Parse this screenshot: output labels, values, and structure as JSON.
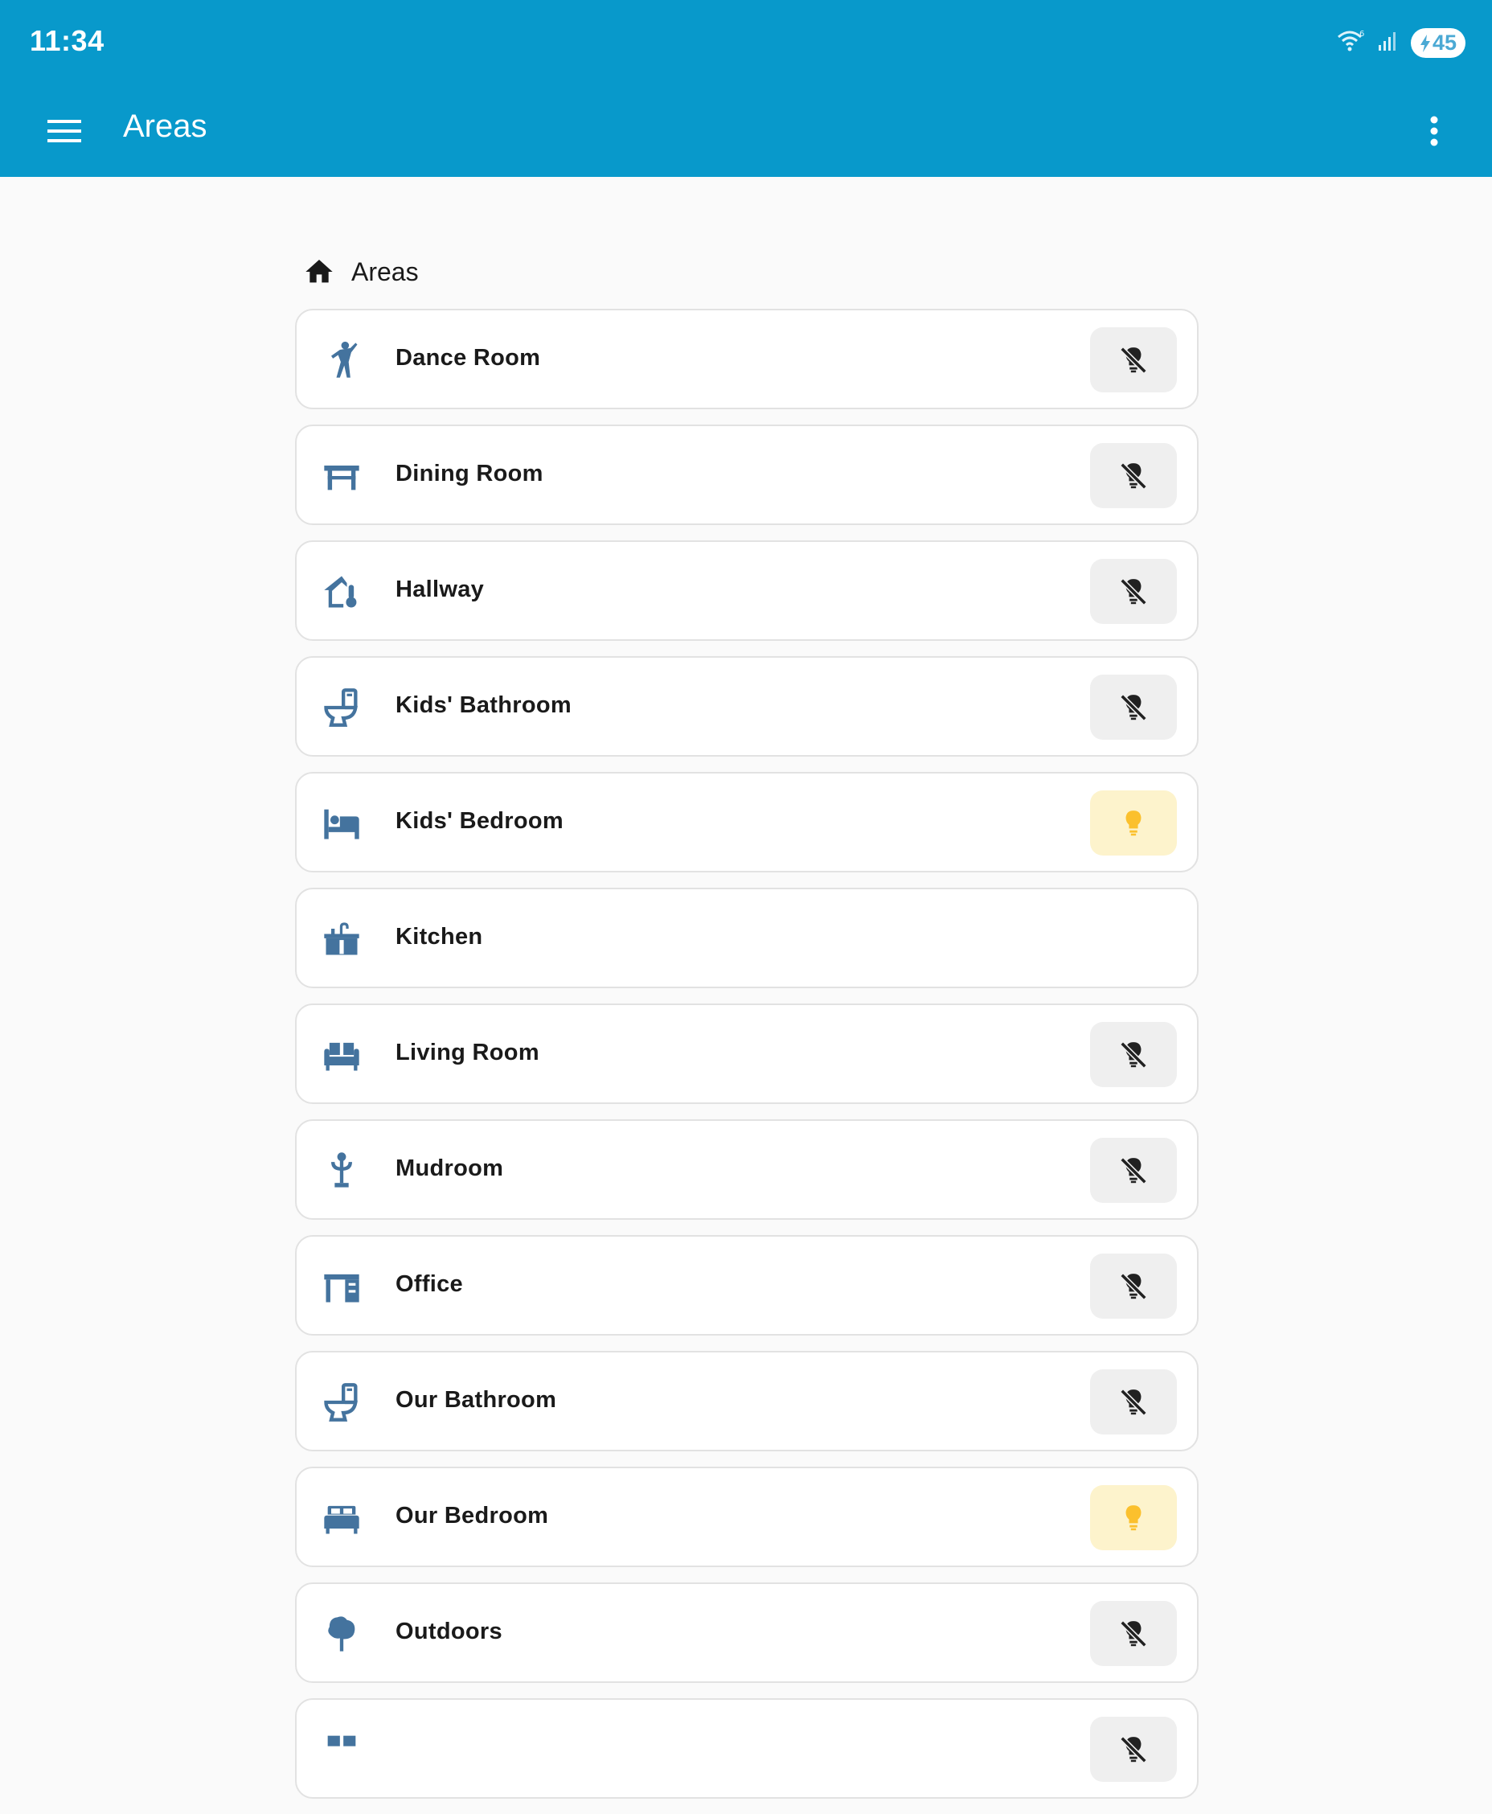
{
  "status_bar": {
    "time": "11:34",
    "battery_level": "45",
    "icons": [
      "wifi-icon",
      "signal-icon",
      "battery-charging-icon"
    ]
  },
  "app_bar": {
    "title": "Areas",
    "menu_icon": "menu-icon",
    "more_icon": "more-vertical-icon"
  },
  "section": {
    "title": "Areas",
    "icon": "home-icon"
  },
  "colors": {
    "header": "#0899cb",
    "area_icon": "#44739e",
    "light_on_bg": "#fdf3cc",
    "light_on": "#fbc02d",
    "light_off_bg": "#efefef",
    "light_off": "#212121"
  },
  "areas": [
    {
      "name": "Dance Room",
      "icon": "dance-icon",
      "light": "off"
    },
    {
      "name": "Dining Room",
      "icon": "table-icon",
      "light": "off"
    },
    {
      "name": "Hallway",
      "icon": "home-thermometer-icon",
      "light": "off"
    },
    {
      "name": "Kids' Bathroom",
      "icon": "toilet-icon",
      "light": "off"
    },
    {
      "name": "Kids' Bedroom",
      "icon": "bed-icon",
      "light": "on"
    },
    {
      "name": "Kitchen",
      "icon": "countertop-icon",
      "light": "none"
    },
    {
      "name": "Living Room",
      "icon": "sofa-icon",
      "light": "off"
    },
    {
      "name": "Mudroom",
      "icon": "coat-rack-icon",
      "light": "off"
    },
    {
      "name": "Office",
      "icon": "desk-icon",
      "light": "off"
    },
    {
      "name": "Our Bathroom",
      "icon": "toilet-icon",
      "light": "off"
    },
    {
      "name": "Our Bedroom",
      "icon": "bed-double-icon",
      "light": "on"
    },
    {
      "name": "Outdoors",
      "icon": "tree-icon",
      "light": "off"
    },
    {
      "name": "",
      "icon": "partial-icon",
      "light": "off"
    }
  ]
}
